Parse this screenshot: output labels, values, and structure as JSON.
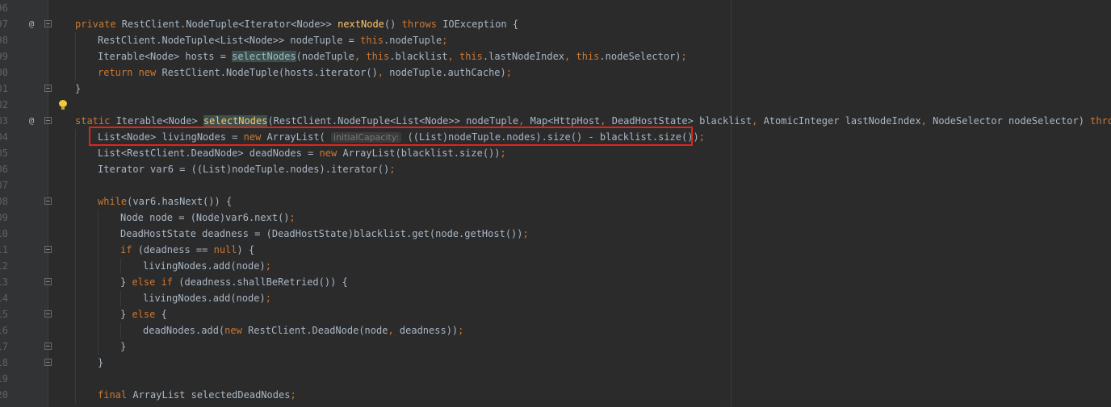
{
  "editor": {
    "lines": [
      {
        "num": "96",
        "indent": 0,
        "override": false,
        "fold": false,
        "tokens": []
      },
      {
        "num": "97",
        "indent": 0,
        "override": true,
        "fold": true,
        "tokens": [
          {
            "t": "private ",
            "c": "kw"
          },
          {
            "t": "RestClient.NodeTuple<Iterator<Node>> "
          },
          {
            "t": "nextNode",
            "c": "fn"
          },
          {
            "t": "() "
          },
          {
            "t": "throws ",
            "c": "kw"
          },
          {
            "t": "IOException {"
          }
        ]
      },
      {
        "num": "98",
        "indent": 1,
        "override": false,
        "fold": false,
        "tokens": [
          {
            "t": "RestClient.NodeTuple<List<Node>> nodeTuple = "
          },
          {
            "t": "this",
            "c": "kw"
          },
          {
            "t": ".nodeTuple"
          },
          {
            "t": ";",
            "c": "kw"
          }
        ]
      },
      {
        "num": "99",
        "indent": 1,
        "override": false,
        "fold": false,
        "tokens": [
          {
            "t": "Iterable<Node> hosts = "
          },
          {
            "t": "selectNodes",
            "c": "hl"
          },
          {
            "t": "(nodeTuple"
          },
          {
            "t": ", ",
            "c": "kw"
          },
          {
            "t": "this",
            "c": "kw"
          },
          {
            "t": ".blacklist"
          },
          {
            "t": ", ",
            "c": "kw"
          },
          {
            "t": "this",
            "c": "kw"
          },
          {
            "t": ".lastNodeIndex"
          },
          {
            "t": ", ",
            "c": "kw"
          },
          {
            "t": "this",
            "c": "kw"
          },
          {
            "t": ".nodeSelector)"
          },
          {
            "t": ";",
            "c": "kw"
          }
        ]
      },
      {
        "num": "00",
        "indent": 1,
        "override": false,
        "fold": false,
        "tokens": [
          {
            "t": "return new ",
            "c": "kw"
          },
          {
            "t": "RestClient.NodeTuple(hosts.iterator()"
          },
          {
            "t": ", ",
            "c": "kw"
          },
          {
            "t": "nodeTuple.authCache)"
          },
          {
            "t": ";",
            "c": "kw"
          }
        ]
      },
      {
        "num": "01",
        "indent": 0,
        "override": false,
        "fold": true,
        "tokens": [
          {
            "t": "}"
          }
        ]
      },
      {
        "num": "02",
        "indent": 0,
        "override": false,
        "fold": false,
        "tokens": []
      },
      {
        "num": "03",
        "indent": 0,
        "override": true,
        "fold": true,
        "tokens": [
          {
            "t": "static ",
            "c": "kw"
          },
          {
            "t": "Iterable<Node> "
          },
          {
            "t": "selectNodes",
            "c": "fn hl"
          },
          {
            "t": "(RestClient.NodeTuple<List<Node>> nodeTuple"
          },
          {
            "t": ", ",
            "c": "kw"
          },
          {
            "t": "Map<HttpHost"
          },
          {
            "t": ", ",
            "c": "kw"
          },
          {
            "t": "DeadHostState> blacklist"
          },
          {
            "t": ", ",
            "c": "kw"
          },
          {
            "t": "AtomicInteger lastNodeIndex"
          },
          {
            "t": ", ",
            "c": "kw"
          },
          {
            "t": "NodeSelector nodeSelector) "
          },
          {
            "t": "throws IO",
            "c": "kw"
          }
        ]
      },
      {
        "num": "04",
        "indent": 1,
        "override": false,
        "fold": false,
        "tokens": [
          {
            "t": "List<Node> livingNodes = "
          },
          {
            "t": "new ",
            "c": "kw"
          },
          {
            "t": "ArrayList( "
          },
          {
            "t": "initialCapacity:",
            "c": "hint"
          },
          {
            "t": " ((List)nodeTuple.nodes).size() - blacklist.size())"
          },
          {
            "t": ";",
            "c": "kw"
          }
        ]
      },
      {
        "num": "05",
        "indent": 1,
        "override": false,
        "fold": false,
        "tokens": [
          {
            "t": "List<RestClient.DeadNode> deadNodes = "
          },
          {
            "t": "new ",
            "c": "kw"
          },
          {
            "t": "ArrayList(blacklist.size())"
          },
          {
            "t": ";",
            "c": "kw"
          }
        ]
      },
      {
        "num": "06",
        "indent": 1,
        "override": false,
        "fold": false,
        "tokens": [
          {
            "t": "Iterator var6 = ((List)nodeTuple.nodes).iterator()"
          },
          {
            "t": ";",
            "c": "kw"
          }
        ]
      },
      {
        "num": "07",
        "indent": 1,
        "override": false,
        "fold": false,
        "tokens": []
      },
      {
        "num": "08",
        "indent": 1,
        "override": false,
        "fold": true,
        "tokens": [
          {
            "t": "while",
            "c": "kw"
          },
          {
            "t": "(var6.hasNext()) {"
          }
        ]
      },
      {
        "num": "09",
        "indent": 2,
        "override": false,
        "fold": false,
        "tokens": [
          {
            "t": "Node node = (Node)var6.next()"
          },
          {
            "t": ";",
            "c": "kw"
          }
        ]
      },
      {
        "num": "10",
        "indent": 2,
        "override": false,
        "fold": false,
        "tokens": [
          {
            "t": "DeadHostState deadness = (DeadHostState)blacklist.get(node.getHost())"
          },
          {
            "t": ";",
            "c": "kw"
          }
        ]
      },
      {
        "num": "11",
        "indent": 2,
        "override": false,
        "fold": true,
        "tokens": [
          {
            "t": "if ",
            "c": "kw"
          },
          {
            "t": "(deadness == "
          },
          {
            "t": "null",
            "c": "kw"
          },
          {
            "t": ") {"
          }
        ]
      },
      {
        "num": "12",
        "indent": 3,
        "override": false,
        "fold": false,
        "tokens": [
          {
            "t": "livingNodes.add(node)"
          },
          {
            "t": ";",
            "c": "kw"
          }
        ]
      },
      {
        "num": "13",
        "indent": 2,
        "override": false,
        "fold": true,
        "tokens": [
          {
            "t": "} "
          },
          {
            "t": "else if ",
            "c": "kw"
          },
          {
            "t": "(deadness.shallBeRetried()) {"
          }
        ]
      },
      {
        "num": "14",
        "indent": 3,
        "override": false,
        "fold": false,
        "tokens": [
          {
            "t": "livingNodes.add(node)"
          },
          {
            "t": ";",
            "c": "kw"
          }
        ]
      },
      {
        "num": "15",
        "indent": 2,
        "override": false,
        "fold": true,
        "tokens": [
          {
            "t": "} "
          },
          {
            "t": "else ",
            "c": "kw"
          },
          {
            "t": "{"
          }
        ]
      },
      {
        "num": "16",
        "indent": 3,
        "override": false,
        "fold": false,
        "tokens": [
          {
            "t": "deadNodes.add("
          },
          {
            "t": "new ",
            "c": "kw"
          },
          {
            "t": "RestClient.DeadNode(node"
          },
          {
            "t": ", ",
            "c": "kw"
          },
          {
            "t": "deadness))"
          },
          {
            "t": ";",
            "c": "kw"
          }
        ]
      },
      {
        "num": "17",
        "indent": 2,
        "override": false,
        "fold": true,
        "tokens": [
          {
            "t": "}"
          }
        ]
      },
      {
        "num": "18",
        "indent": 1,
        "override": false,
        "fold": true,
        "tokens": [
          {
            "t": "}"
          }
        ]
      },
      {
        "num": "19",
        "indent": 1,
        "override": false,
        "fold": false,
        "tokens": []
      },
      {
        "num": "20",
        "indent": 1,
        "override": false,
        "fold": false,
        "tokens": [
          {
            "t": "final ",
            "c": "kw"
          },
          {
            "t": "ArrayList selectedDeadNodes"
          },
          {
            "t": ";",
            "c": "kw"
          }
        ]
      }
    ],
    "override_marker": "@",
    "highlighted_line": "04",
    "colors": {
      "background": "#2b2b2b",
      "keyword": "#cc7832",
      "method": "#ffc66d",
      "text": "#a9b7c6",
      "highlight_box": "#e1251b"
    }
  }
}
